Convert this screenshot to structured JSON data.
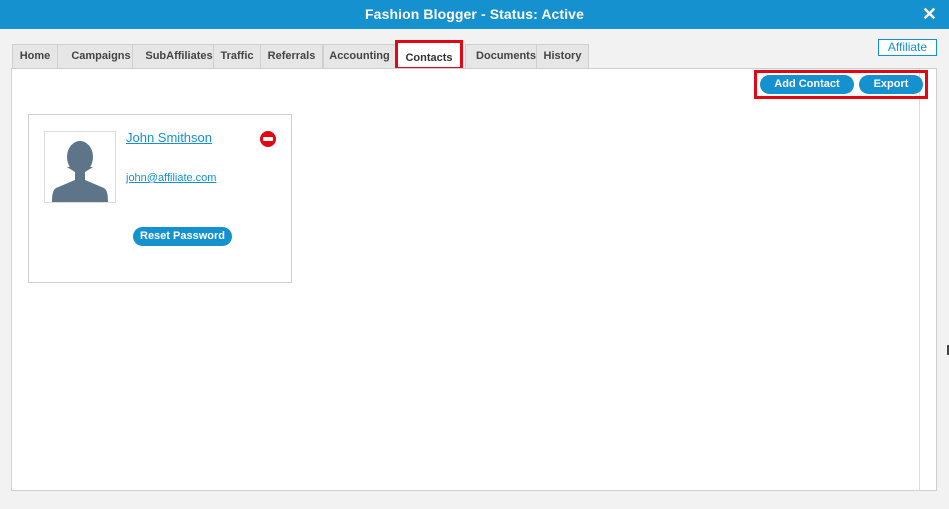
{
  "window": {
    "title": "Fashion Blogger - Status: Active",
    "close_glyph": "✕"
  },
  "badge": {
    "label": "Affiliate"
  },
  "tabs": [
    {
      "label": "Home"
    },
    {
      "label": "Campaigns"
    },
    {
      "label": "SubAffiliates"
    },
    {
      "label": "Traffic"
    },
    {
      "label": "Referrals"
    },
    {
      "label": "Accounting"
    },
    {
      "label": "Contacts",
      "active": true
    },
    {
      "label": "Documents"
    },
    {
      "label": "History"
    }
  ],
  "actions": {
    "add_contact_label": "Add Contact",
    "export_label": "Export"
  },
  "contact": {
    "name": "John Smithson",
    "email": "john@affiliate.com",
    "reset_password_label": "Reset Password",
    "avatar_icon": "user-silhouette-icon",
    "remove_icon": "remove-circle-icon"
  },
  "colors": {
    "brand": "#1591d0",
    "highlight": "#e30613"
  }
}
